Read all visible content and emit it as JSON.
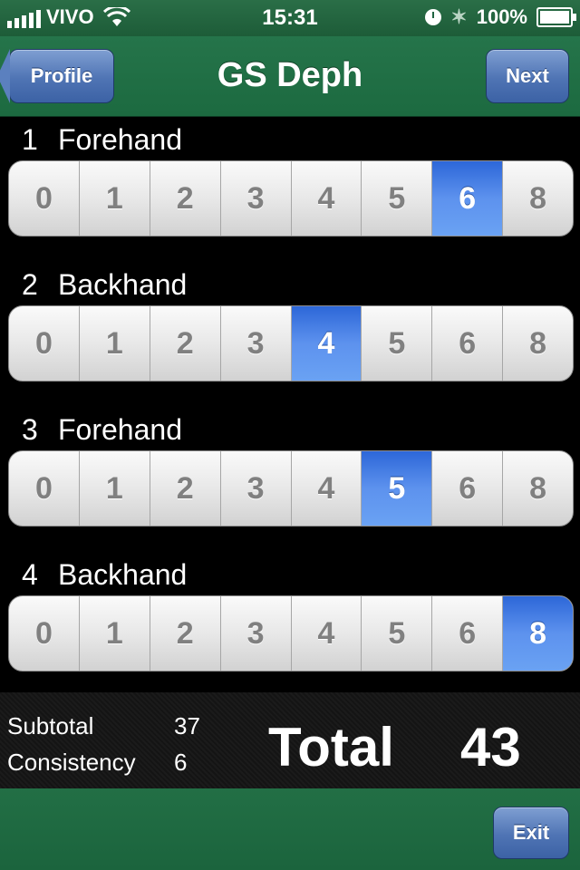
{
  "status_bar": {
    "carrier": "VIVO",
    "time": "15:31",
    "battery": "100%",
    "icons": [
      "signal-icon",
      "wifi-icon",
      "clock-icon",
      "bluetooth-icon",
      "battery-icon"
    ]
  },
  "nav": {
    "back_label": "Profile",
    "title": "GS Deph",
    "next_label": "Next"
  },
  "rows": [
    {
      "num": "1",
      "label": "Forehand",
      "options": [
        "0",
        "1",
        "2",
        "3",
        "4",
        "5",
        "6",
        "8"
      ],
      "selected_index": 6
    },
    {
      "num": "2",
      "label": "Backhand",
      "options": [
        "0",
        "1",
        "2",
        "3",
        "4",
        "5",
        "6",
        "8"
      ],
      "selected_index": 4
    },
    {
      "num": "3",
      "label": "Forehand",
      "options": [
        "0",
        "1",
        "2",
        "3",
        "4",
        "5",
        "6",
        "8"
      ],
      "selected_index": 5
    },
    {
      "num": "4",
      "label": "Backhand",
      "options": [
        "0",
        "1",
        "2",
        "3",
        "4",
        "5",
        "6",
        "8"
      ],
      "selected_index": 7
    }
  ],
  "summary": {
    "subtotal_label": "Subtotal",
    "subtotal_value": "37",
    "consistency_label": "Consistency",
    "consistency_value": "6",
    "total_label": "Total",
    "total_value": "43"
  },
  "footer": {
    "exit_label": "Exit"
  },
  "colors": {
    "bar_green": "#1f6a42",
    "button_blue": "#4f74b4",
    "selected_blue": "#4a80e8"
  }
}
